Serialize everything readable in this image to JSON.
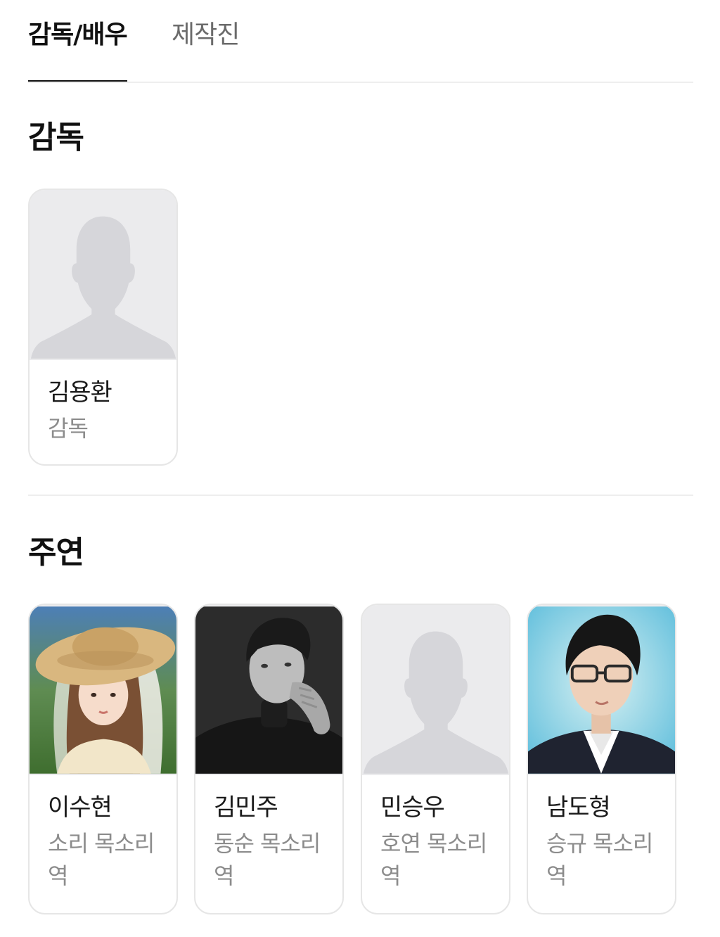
{
  "tabs": [
    {
      "label": "감독/배우",
      "active": true
    },
    {
      "label": "제작진",
      "active": false
    }
  ],
  "sections": {
    "director": {
      "title": "감독",
      "people": [
        {
          "name": "김용환",
          "role": "감독",
          "photo": "placeholder-silhouette"
        }
      ]
    },
    "main_cast": {
      "title": "주연",
      "people": [
        {
          "name": "이수현",
          "role": "소리 목소리 역",
          "photo": "woman-straw-hat"
        },
        {
          "name": "김민주",
          "role": "동순 목소리 역",
          "photo": "man-bw-portrait"
        },
        {
          "name": "민승우",
          "role": "호연 목소리 역",
          "photo": "placeholder-silhouette"
        },
        {
          "name": "남도형",
          "role": "승규 목소리 역",
          "photo": "man-glasses-portrait"
        }
      ]
    }
  },
  "colors": {
    "text_primary": "#111111",
    "text_secondary": "#8c8c8c",
    "tab_inactive": "#6b6b6b",
    "placeholder_bg": "#ebebed",
    "silhouette": "#d6d6da",
    "divider": "#eeeeee"
  }
}
